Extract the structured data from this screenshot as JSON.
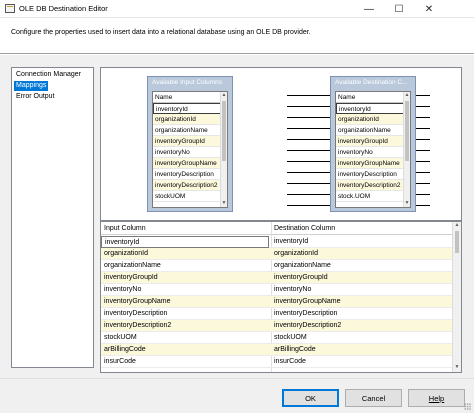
{
  "window": {
    "title": "OLE DB Destination Editor",
    "minimize_glyph": "—",
    "maximize_glyph": "☐",
    "close_glyph": "✕"
  },
  "header": {
    "description": "Configure the properties used to insert data into a relational database using an OLE DB provider."
  },
  "nav": {
    "items": [
      "Connection Manager",
      "Mappings",
      "Error Output"
    ],
    "selected": "Mappings"
  },
  "mapping": {
    "input_box_title": "Available Input Columns",
    "dest_box_title": "Available Destination C...",
    "name_header": "Name",
    "input_columns": [
      "inventoryId",
      "organizationId",
      "organizationName",
      "inventoryGroupId",
      "inventoryNo",
      "inventoryGroupName",
      "inventoryDescription",
      "inventoryDescription2",
      "stockUOM"
    ],
    "dest_columns": [
      "inventoryId",
      "organizationId",
      "organizationName",
      "inventoryGroupId",
      "inventoryNo",
      "inventoryGroupName",
      "inventoryDescription",
      "inventoryDescription2",
      "stock.UOM"
    ]
  },
  "grid": {
    "col_input": "Input Column",
    "col_dest": "Destination Column",
    "rows": [
      {
        "input": "inventoryId",
        "dest": "inventoryId"
      },
      {
        "input": "organizationId",
        "dest": "organizationId"
      },
      {
        "input": "organizationName",
        "dest": "organizationName"
      },
      {
        "input": "inventoryGroupId",
        "dest": "inventoryGroupId"
      },
      {
        "input": "inventoryNo",
        "dest": "inventoryNo"
      },
      {
        "input": "inventoryGroupName",
        "dest": "inventoryGroupName"
      },
      {
        "input": "inventoryDescription",
        "dest": "inventoryDescription"
      },
      {
        "input": "inventoryDescription2",
        "dest": "inventoryDescription2"
      },
      {
        "input": "stockUOM",
        "dest": "stockUOM"
      },
      {
        "input": "arBillingCode",
        "dest": "arBillingCode"
      },
      {
        "input": "insurCode",
        "dest": "insurCode"
      }
    ]
  },
  "footer": {
    "ok": "OK",
    "cancel": "Cancel",
    "help": "Help"
  }
}
